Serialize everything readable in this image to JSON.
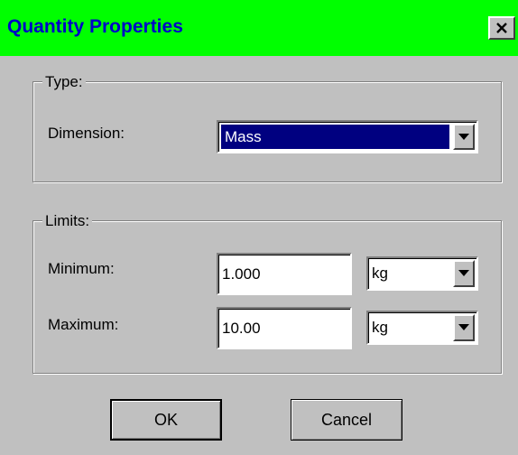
{
  "window": {
    "title": "Quantity Properties",
    "close_icon": "close-icon",
    "titlebar_color": "#00ff00",
    "title_color": "#0000c8"
  },
  "type_group": {
    "legend": "Type:",
    "dimension_label": "Dimension:",
    "dimension_value": "Mass"
  },
  "limits_group": {
    "legend": "Limits:",
    "minimum_label": "Minimum:",
    "minimum_value": "1.000",
    "minimum_unit": "kg",
    "maximum_label": "Maximum:",
    "maximum_value": "10.00",
    "maximum_unit": "kg"
  },
  "buttons": {
    "ok": "OK",
    "cancel": "Cancel"
  }
}
